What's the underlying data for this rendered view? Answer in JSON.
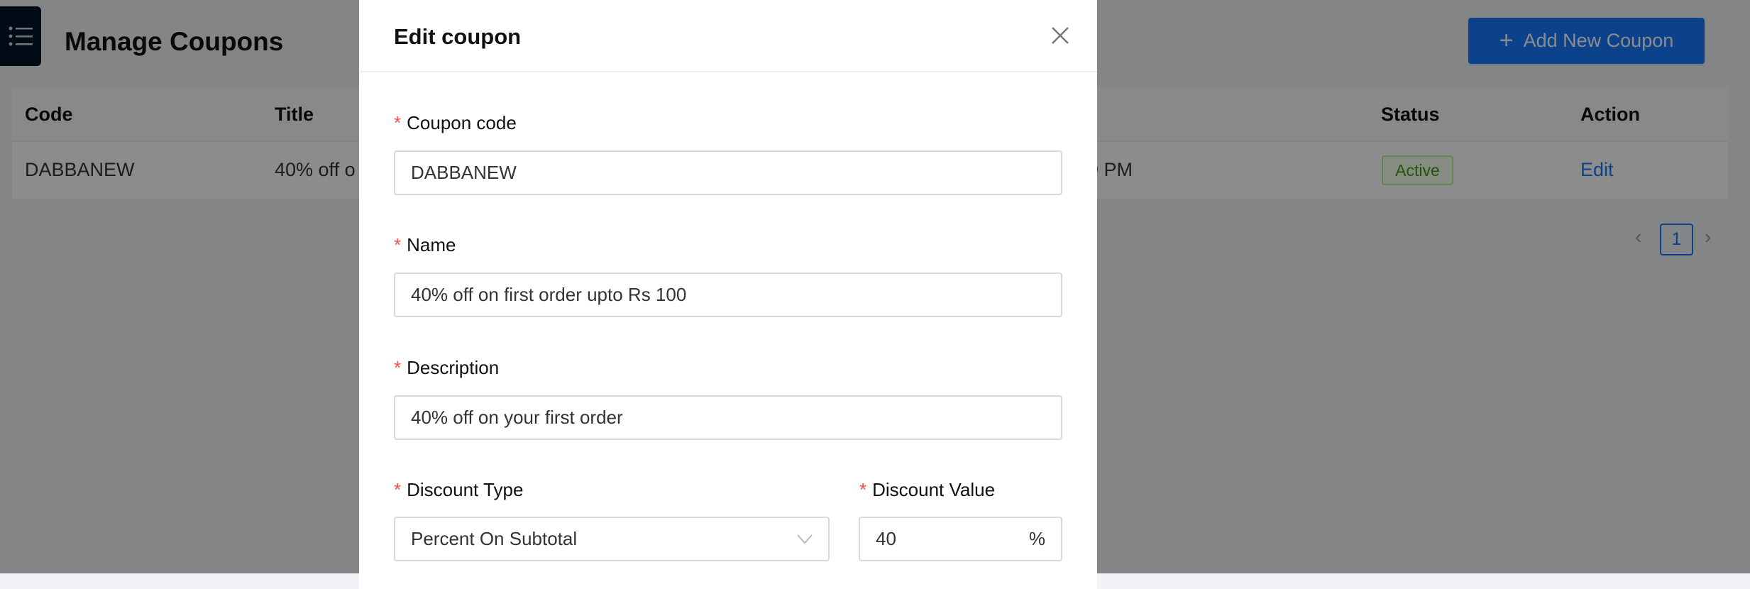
{
  "page": {
    "title": "Manage Coupons",
    "add_button": "Add New Coupon"
  },
  "table": {
    "headers": {
      "code": "Code",
      "title": "Title",
      "status": "Status",
      "action": "Action"
    },
    "rows": [
      {
        "code": "DABBANEW",
        "title": "40% off o",
        "hidden_fragment": "9 PM",
        "status": "Active",
        "action": "Edit"
      }
    ]
  },
  "pagination": {
    "current": "1"
  },
  "modal": {
    "title": "Edit coupon",
    "fields": {
      "coupon_code": {
        "label": "Coupon code",
        "value": "DABBANEW"
      },
      "name": {
        "label": "Name",
        "value": "40% off on first order upto Rs 100"
      },
      "description": {
        "label": "Description",
        "value": "40% off on your first order"
      },
      "discount_type": {
        "label": "Discount Type",
        "value": "Percent On Subtotal"
      },
      "discount_value": {
        "label": "Discount Value",
        "value": "40",
        "suffix": "%"
      }
    },
    "required_mark": "*"
  },
  "colors": {
    "primary": "#1677ff",
    "sidebar": "#001529",
    "active_green": "#389e0d",
    "required": "#ff4d4f"
  }
}
